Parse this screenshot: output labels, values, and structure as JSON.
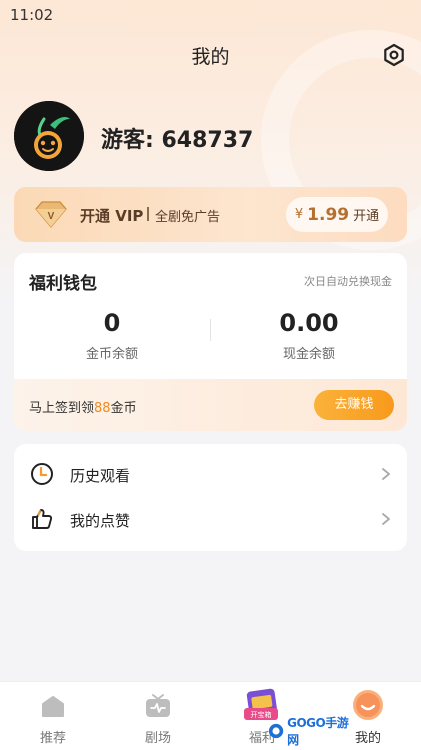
{
  "status_bar": {
    "time": "11:02"
  },
  "header": {
    "title": "我的",
    "settings_icon": "gear-icon"
  },
  "profile": {
    "username": "游客: 648737"
  },
  "vip": {
    "title": "开通 VIP",
    "desc": "全剧免广告",
    "currency": "¥",
    "price": "1.99",
    "button_label": "开通"
  },
  "wallet": {
    "title": "福利钱包",
    "hint": "次日自动兑换现金",
    "coins_value": "0",
    "coins_label": "金币余额",
    "cash_value": "0.00",
    "cash_label": "现金余额",
    "checkin_prefix": "马上签到领",
    "checkin_amount": "88",
    "checkin_suffix": "金币",
    "earn_button": "去赚钱"
  },
  "menu": [
    {
      "label": "历史观看",
      "icon": "clock-icon"
    },
    {
      "label": "我的点赞",
      "icon": "thumbs-up-icon"
    }
  ],
  "tabbar": {
    "tabs": [
      {
        "label": "推荐",
        "icon": "home-icon"
      },
      {
        "label": "剧场",
        "icon": "tv-icon"
      },
      {
        "label": "福利",
        "icon": "treasure-box-icon",
        "badge": "开宝箱"
      },
      {
        "label": "我的",
        "icon": "smile-icon"
      }
    ],
    "active_index": 3
  },
  "watermark": {
    "text": "GOGO手游网"
  },
  "colors": {
    "accent": "#f79a1c",
    "vip_text": "#5a3d26",
    "price": "#b5702f"
  }
}
